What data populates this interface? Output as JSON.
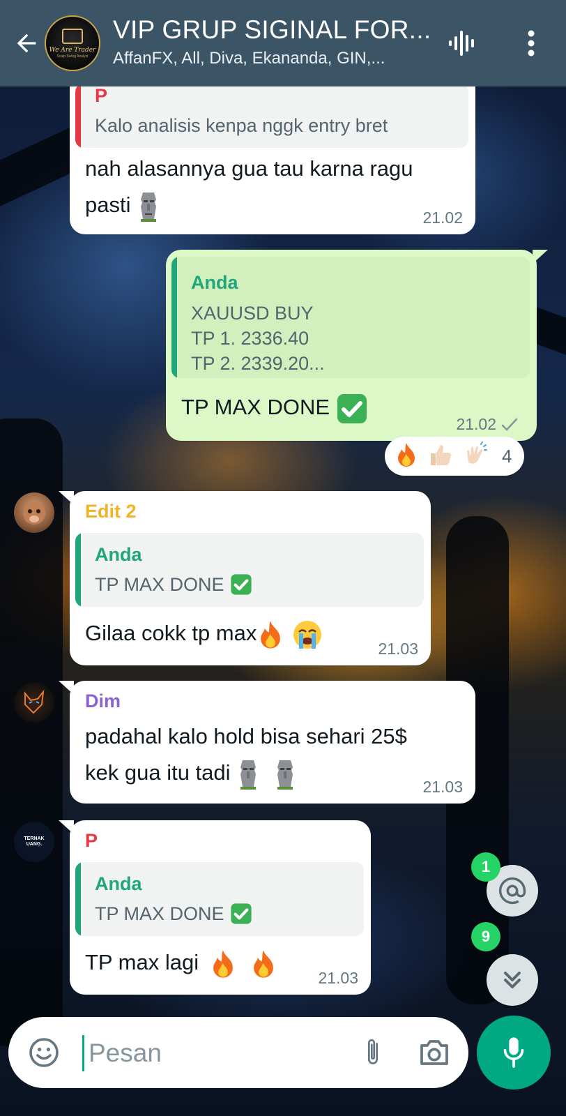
{
  "header": {
    "title": "VIP GRUP SIGINAL FOR...",
    "members": "AffanFX, All, Diva, Ekananda, GIN,...",
    "avatar_text": "We Are Trader",
    "avatar_subtext": "Scalp Swing Analyst",
    "icons": {
      "back": "arrow-left-icon",
      "voice": "voice-chat-icon",
      "menu": "more-vertical-icon"
    }
  },
  "messages": [
    {
      "id": "m1",
      "direction": "in",
      "quote": {
        "author": "P",
        "text": "Kalo analisis kenpa nggk entry bret"
      },
      "text_line1": "nah alasannya gua tau karna ragu",
      "text_line2": "pasti",
      "time": "21.02"
    },
    {
      "id": "m2",
      "direction": "out",
      "quote": {
        "author": "Anda",
        "lines": [
          "XAUUSD BUY",
          "TP 1. 2336.40",
          "TP 2. 2339.20..."
        ]
      },
      "text": "TP MAX DONE",
      "time": "21.02",
      "status": "sent",
      "reactions": {
        "emojis": [
          "fire",
          "thumbs-up",
          "clapping-hands"
        ],
        "count": "4"
      }
    },
    {
      "id": "m3",
      "direction": "in",
      "sender": "Edit 2",
      "quote": {
        "author": "Anda",
        "text": "TP MAX DONE"
      },
      "text": "Gilaa cokk tp max",
      "time": "21.03"
    },
    {
      "id": "m4",
      "direction": "in",
      "sender": "Dim",
      "text_line1": "padahal kalo hold bisa sehari 25$",
      "text_line2": "kek gua itu tadi",
      "time": "21.03"
    },
    {
      "id": "m5",
      "direction": "in",
      "sender": "P",
      "quote": {
        "author": "Anda",
        "text": "TP MAX DONE"
      },
      "text": "TP max lagi",
      "time": "21.03"
    }
  ],
  "member_avatar_text": "TERNAK UANG.",
  "floating": {
    "mentions_badge": "1",
    "unread_badge": "9"
  },
  "input": {
    "placeholder": "Pesan"
  },
  "colors": {
    "header": "#3c5566",
    "outgoing_bubble": "#dcf8c6",
    "incoming_bubble": "#ffffff",
    "accent": "#00a884",
    "sender_p": "#e53945",
    "sender_edit2": "#f0b429",
    "sender_dim": "#8a63d2",
    "quote_anda": "#1fa67a"
  }
}
